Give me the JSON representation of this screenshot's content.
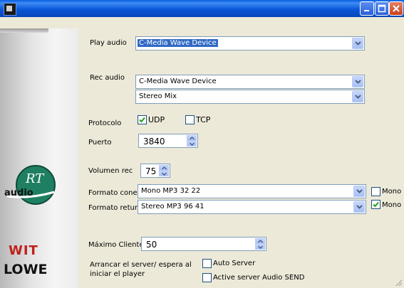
{
  "titlebar": {
    "buttons": [
      "minimize-icon",
      "maximize-icon",
      "close-icon"
    ],
    "colors": {
      "bar": "#0a57d8",
      "close": "#c8411e"
    }
  },
  "sidebar": {
    "logo_top": "RT",
    "logo_bottom": "audio",
    "brand_line1": "WIT",
    "brand_line2": "LOWE"
  },
  "play_audio": {
    "label": "Play audio",
    "value": "C-Media Wave Device"
  },
  "rec_audio": {
    "label": "Rec audio",
    "device": "C-Media Wave Device",
    "line": "Stereo Mix"
  },
  "protocolo": {
    "label": "Protocolo",
    "options": [
      {
        "label": "UDP",
        "checked": true
      },
      {
        "label": "TCP",
        "checked": false
      }
    ]
  },
  "puerto": {
    "label": "Puerto",
    "value": "3840"
  },
  "volumen_rec": {
    "label": "Volumen rec",
    "value": "75"
  },
  "formato_conex": {
    "label": "Formato conex",
    "value": "Mono   MP3 32 22",
    "mono_label": "Mono",
    "mono_checked": false
  },
  "formato_return": {
    "label": "Formato return",
    "value": "Stereo MP3  96  41",
    "mono_label": "Mono",
    "mono_checked": true
  },
  "maximo_clientes": {
    "label": "Máximo Clientes",
    "value": "50"
  },
  "arrancar": {
    "label_line1": "Arrancar el server/ espera al",
    "label_line2": "iniciar el player",
    "options": [
      {
        "label": "Auto Server",
        "checked": false
      },
      {
        "label": "Active server Audio SEND",
        "checked": false
      }
    ]
  },
  "colors": {
    "selection": "#316ac5",
    "checkmark": "#21a121",
    "brand_red": "#c0201a"
  }
}
